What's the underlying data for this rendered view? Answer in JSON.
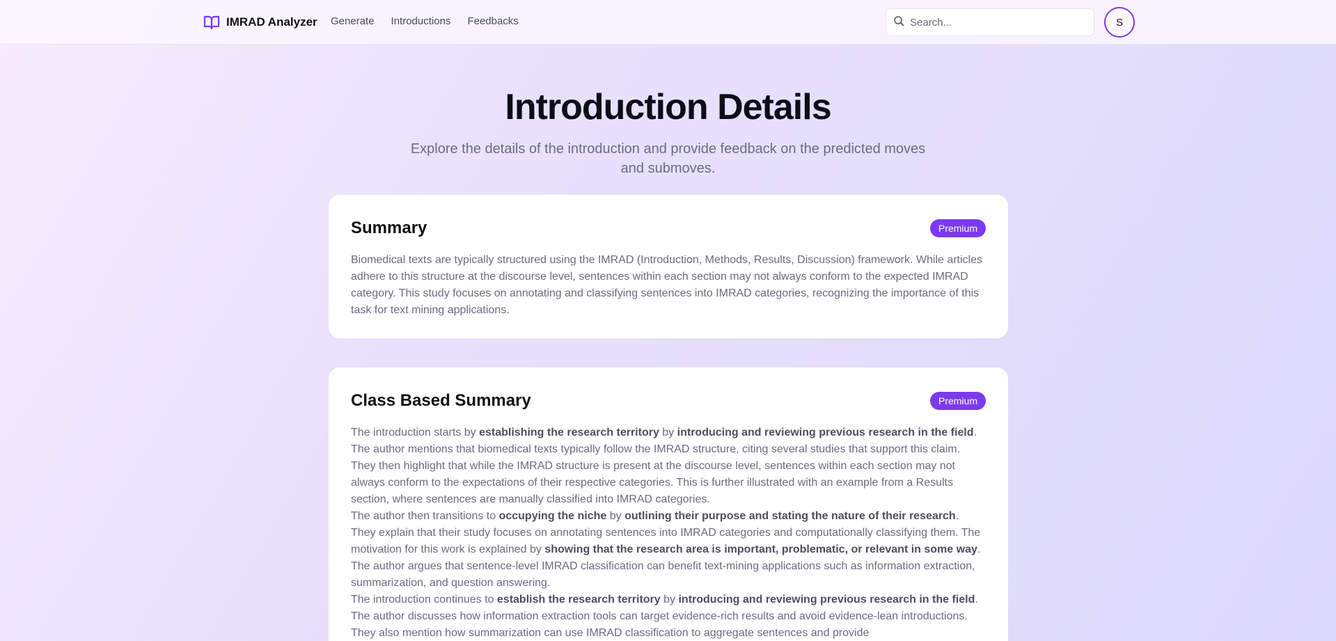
{
  "nav": {
    "brand": "IMRAD Analyzer",
    "links": [
      "Generate",
      "Introductions",
      "Feedbacks"
    ],
    "search_placeholder": "Search...",
    "avatar_initial": "S"
  },
  "hero": {
    "title": "Introduction Details",
    "subtitle": "Explore the details of the introduction and provide feedback on the predicted moves and submoves."
  },
  "summary_card": {
    "title": "Summary",
    "badge": "Premium",
    "text": "Biomedical texts are typically structured using the IMRAD (Introduction, Methods, Results, Discussion) framework. While articles adhere to this structure at the discourse level, sentences within each section may not always conform to the expected IMRAD category. This study focuses on annotating and classifying sentences into IMRAD categories, recognizing the importance of this task for text mining applications."
  },
  "class_card": {
    "title": "Class Based Summary",
    "badge": "Premium",
    "paragraphs": [
      [
        {
          "t": "The introduction starts by "
        },
        {
          "t": "establishing the research territory",
          "b": true
        },
        {
          "t": " by "
        },
        {
          "t": "introducing and reviewing previous research in the field",
          "b": true
        },
        {
          "t": ". The author mentions that biomedical texts typically follow the IMRAD structure, citing several studies that support this claim. They then highlight that while the IMRAD structure is present at the discourse level, sentences within each section may not always conform to the expectations of their respective categories. This is further illustrated with an example from a Results section, where sentences are manually classified into IMRAD categories."
        }
      ],
      [
        {
          "t": "The author then transitions to "
        },
        {
          "t": "occupying the niche",
          "b": true
        },
        {
          "t": " by "
        },
        {
          "t": "outlining their purpose and stating the nature of their research",
          "b": true
        },
        {
          "t": ". They explain that their study focuses on annotating sentences into IMRAD categories and computationally classifying them. The motivation for this work is explained by "
        },
        {
          "t": "showing that the research area is important, problematic, or relevant in some way",
          "b": true
        },
        {
          "t": ". The author argues that sentence-level IMRAD classification can benefit text-mining applications such as information extraction, summarization, and question answering."
        }
      ],
      [
        {
          "t": "The introduction continues to "
        },
        {
          "t": "establish the research territory",
          "b": true
        },
        {
          "t": " by "
        },
        {
          "t": "introducing and reviewing previous research in the field",
          "b": true
        },
        {
          "t": ". The author discusses how information extraction tools can target evidence-rich results and avoid evidence-lean introductions. They also mention how summarization can use IMRAD classification to aggregate sentences and provide"
        }
      ]
    ]
  }
}
